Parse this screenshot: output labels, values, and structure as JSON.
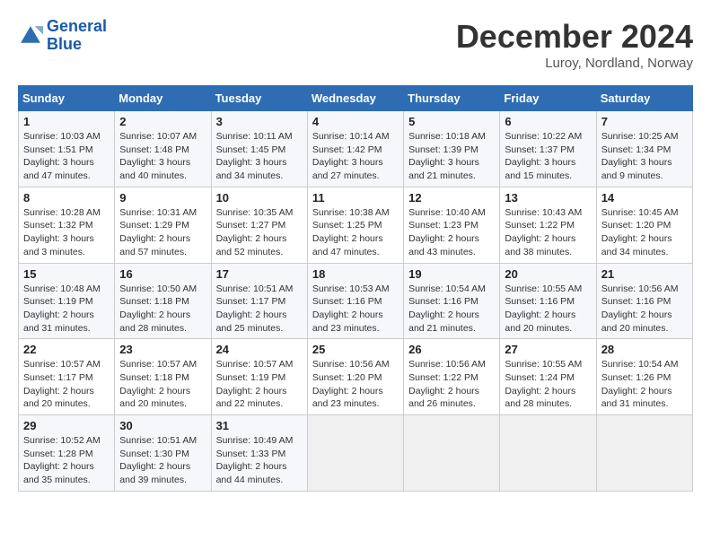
{
  "header": {
    "logo_line1": "General",
    "logo_line2": "Blue",
    "month": "December 2024",
    "location": "Luroy, Nordland, Norway"
  },
  "weekdays": [
    "Sunday",
    "Monday",
    "Tuesday",
    "Wednesday",
    "Thursday",
    "Friday",
    "Saturday"
  ],
  "weeks": [
    [
      {
        "day": "1",
        "sunrise": "10:03 AM",
        "sunset": "1:51 PM",
        "daylight": "3 hours and 47 minutes."
      },
      {
        "day": "2",
        "sunrise": "10:07 AM",
        "sunset": "1:48 PM",
        "daylight": "3 hours and 40 minutes."
      },
      {
        "day": "3",
        "sunrise": "10:11 AM",
        "sunset": "1:45 PM",
        "daylight": "3 hours and 34 minutes."
      },
      {
        "day": "4",
        "sunrise": "10:14 AM",
        "sunset": "1:42 PM",
        "daylight": "3 hours and 27 minutes."
      },
      {
        "day": "5",
        "sunrise": "10:18 AM",
        "sunset": "1:39 PM",
        "daylight": "3 hours and 21 minutes."
      },
      {
        "day": "6",
        "sunrise": "10:22 AM",
        "sunset": "1:37 PM",
        "daylight": "3 hours and 15 minutes."
      },
      {
        "day": "7",
        "sunrise": "10:25 AM",
        "sunset": "1:34 PM",
        "daylight": "3 hours and 9 minutes."
      }
    ],
    [
      {
        "day": "8",
        "sunrise": "10:28 AM",
        "sunset": "1:32 PM",
        "daylight": "3 hours and 3 minutes."
      },
      {
        "day": "9",
        "sunrise": "10:31 AM",
        "sunset": "1:29 PM",
        "daylight": "2 hours and 57 minutes."
      },
      {
        "day": "10",
        "sunrise": "10:35 AM",
        "sunset": "1:27 PM",
        "daylight": "2 hours and 52 minutes."
      },
      {
        "day": "11",
        "sunrise": "10:38 AM",
        "sunset": "1:25 PM",
        "daylight": "2 hours and 47 minutes."
      },
      {
        "day": "12",
        "sunrise": "10:40 AM",
        "sunset": "1:23 PM",
        "daylight": "2 hours and 43 minutes."
      },
      {
        "day": "13",
        "sunrise": "10:43 AM",
        "sunset": "1:22 PM",
        "daylight": "2 hours and 38 minutes."
      },
      {
        "day": "14",
        "sunrise": "10:45 AM",
        "sunset": "1:20 PM",
        "daylight": "2 hours and 34 minutes."
      }
    ],
    [
      {
        "day": "15",
        "sunrise": "10:48 AM",
        "sunset": "1:19 PM",
        "daylight": "2 hours and 31 minutes."
      },
      {
        "day": "16",
        "sunrise": "10:50 AM",
        "sunset": "1:18 PM",
        "daylight": "2 hours and 28 minutes."
      },
      {
        "day": "17",
        "sunrise": "10:51 AM",
        "sunset": "1:17 PM",
        "daylight": "2 hours and 25 minutes."
      },
      {
        "day": "18",
        "sunrise": "10:53 AM",
        "sunset": "1:16 PM",
        "daylight": "2 hours and 23 minutes."
      },
      {
        "day": "19",
        "sunrise": "10:54 AM",
        "sunset": "1:16 PM",
        "daylight": "2 hours and 21 minutes."
      },
      {
        "day": "20",
        "sunrise": "10:55 AM",
        "sunset": "1:16 PM",
        "daylight": "2 hours and 20 minutes."
      },
      {
        "day": "21",
        "sunrise": "10:56 AM",
        "sunset": "1:16 PM",
        "daylight": "2 hours and 20 minutes."
      }
    ],
    [
      {
        "day": "22",
        "sunrise": "10:57 AM",
        "sunset": "1:17 PM",
        "daylight": "2 hours and 20 minutes."
      },
      {
        "day": "23",
        "sunrise": "10:57 AM",
        "sunset": "1:18 PM",
        "daylight": "2 hours and 20 minutes."
      },
      {
        "day": "24",
        "sunrise": "10:57 AM",
        "sunset": "1:19 PM",
        "daylight": "2 hours and 22 minutes."
      },
      {
        "day": "25",
        "sunrise": "10:56 AM",
        "sunset": "1:20 PM",
        "daylight": "2 hours and 23 minutes."
      },
      {
        "day": "26",
        "sunrise": "10:56 AM",
        "sunset": "1:22 PM",
        "daylight": "2 hours and 26 minutes."
      },
      {
        "day": "27",
        "sunrise": "10:55 AM",
        "sunset": "1:24 PM",
        "daylight": "2 hours and 28 minutes."
      },
      {
        "day": "28",
        "sunrise": "10:54 AM",
        "sunset": "1:26 PM",
        "daylight": "2 hours and 31 minutes."
      }
    ],
    [
      {
        "day": "29",
        "sunrise": "10:52 AM",
        "sunset": "1:28 PM",
        "daylight": "2 hours and 35 minutes."
      },
      {
        "day": "30",
        "sunrise": "10:51 AM",
        "sunset": "1:30 PM",
        "daylight": "2 hours and 39 minutes."
      },
      {
        "day": "31",
        "sunrise": "10:49 AM",
        "sunset": "1:33 PM",
        "daylight": "2 hours and 44 minutes."
      },
      null,
      null,
      null,
      null
    ]
  ]
}
